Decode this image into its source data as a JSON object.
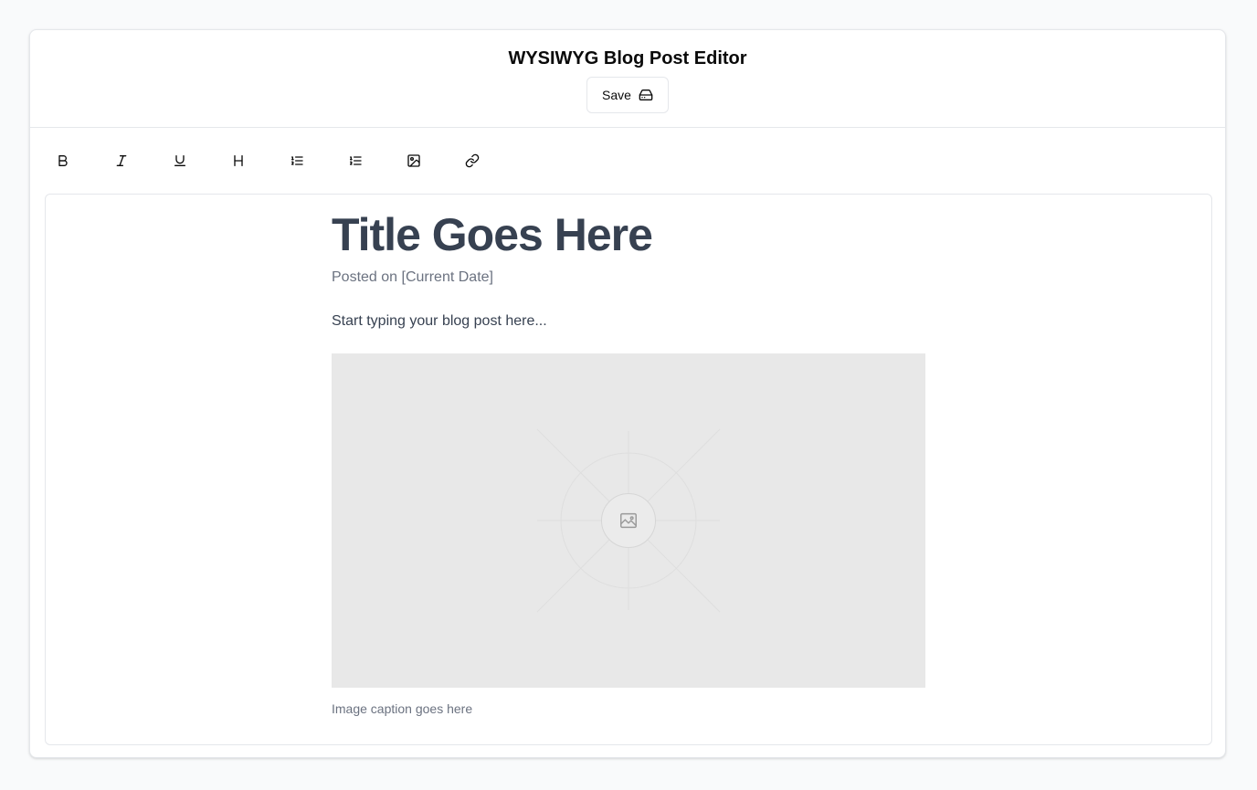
{
  "header": {
    "title": "WYSIWYG Blog Post Editor",
    "save_label": "Save"
  },
  "toolbar": {
    "items": [
      {
        "icon": "bold-icon",
        "glyph": "B"
      },
      {
        "icon": "italic-icon"
      },
      {
        "icon": "underline-icon"
      },
      {
        "icon": "heading-icon",
        "glyph": "H"
      },
      {
        "icon": "ordered-list-icon"
      },
      {
        "icon": "list-icon"
      },
      {
        "icon": "image-icon"
      },
      {
        "icon": "link-icon"
      }
    ]
  },
  "post": {
    "title": "Title Goes Here",
    "date": "Posted on [Current Date]",
    "body": "Start typing your blog post here...",
    "caption": "Image caption goes here"
  },
  "colors": {
    "title": "#374151",
    "muted": "#6b7280",
    "border": "#e5e7eb",
    "placeholder_bg": "#e8e8e8"
  }
}
